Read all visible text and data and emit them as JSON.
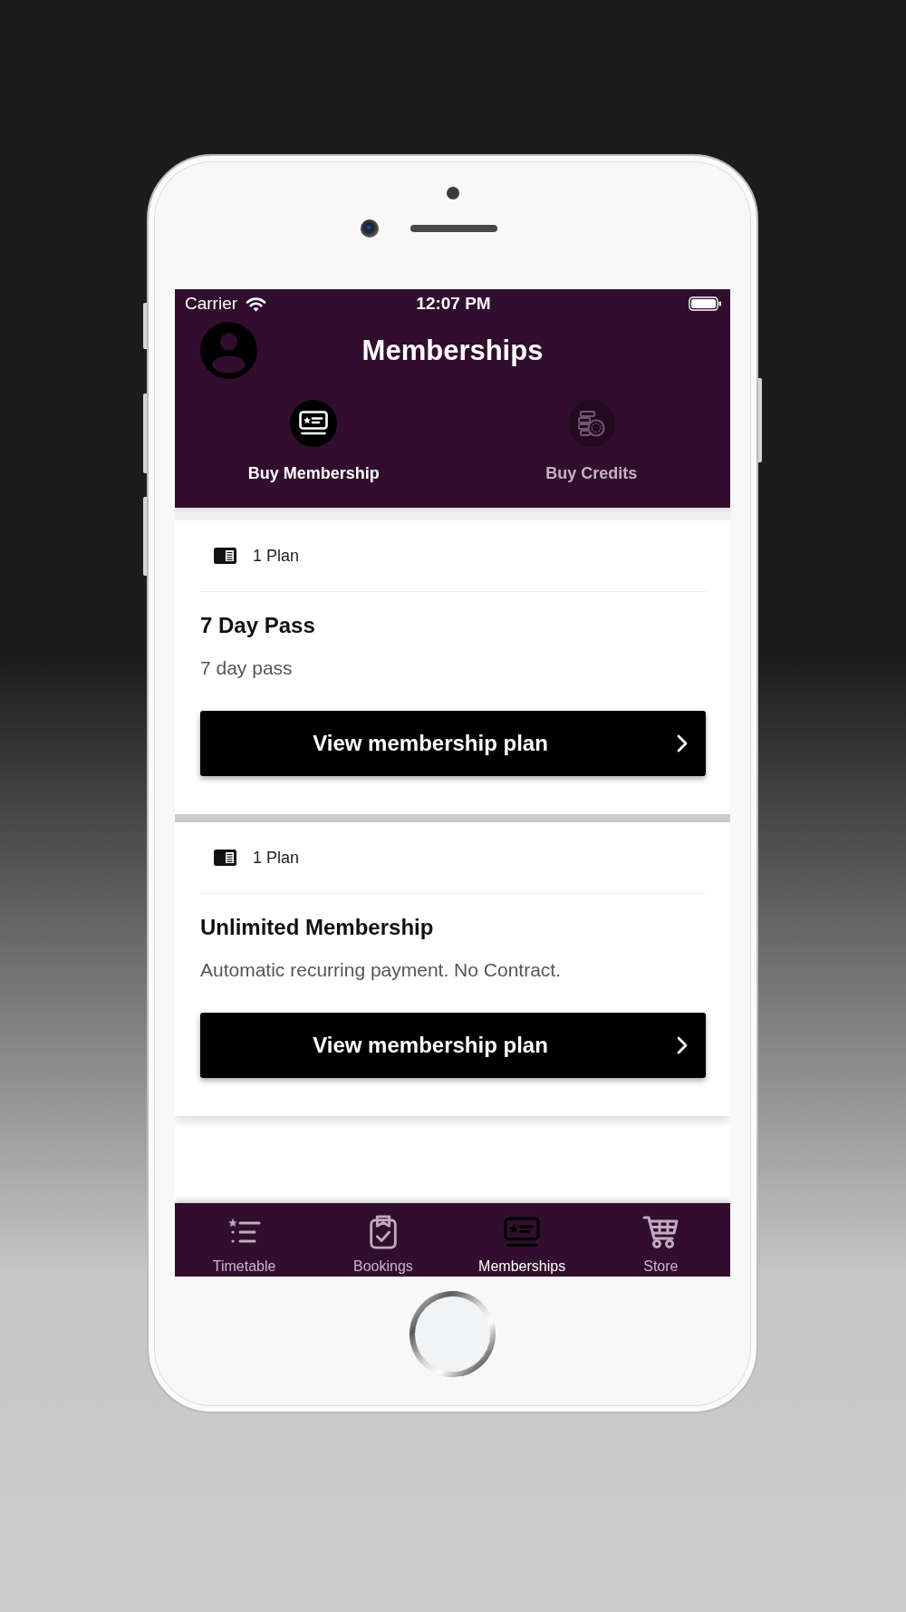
{
  "status_bar": {
    "carrier": "Carrier",
    "time": "12:07 PM"
  },
  "header": {
    "title": "Memberships"
  },
  "tabs": [
    {
      "label": "Buy Membership",
      "kind": "membership",
      "selected": true
    },
    {
      "label": "Buy Credits",
      "kind": "credits",
      "selected": false
    }
  ],
  "plans": [
    {
      "count": "1 Plan",
      "title": "7 Day Pass",
      "description": "7 day pass",
      "button": "View membership plan"
    },
    {
      "count": "1 Plan",
      "title": "Unlimited Membership",
      "description": "Automatic recurring payment. No Contract.",
      "button": "View membership plan"
    }
  ],
  "bottom_nav": [
    {
      "label": "Timetable",
      "kind": "timetable",
      "selected": false
    },
    {
      "label": "Bookings",
      "kind": "bookings",
      "selected": false
    },
    {
      "label": "Memberships",
      "kind": "memberships",
      "selected": true
    },
    {
      "label": "Store",
      "kind": "store",
      "selected": false
    }
  ]
}
